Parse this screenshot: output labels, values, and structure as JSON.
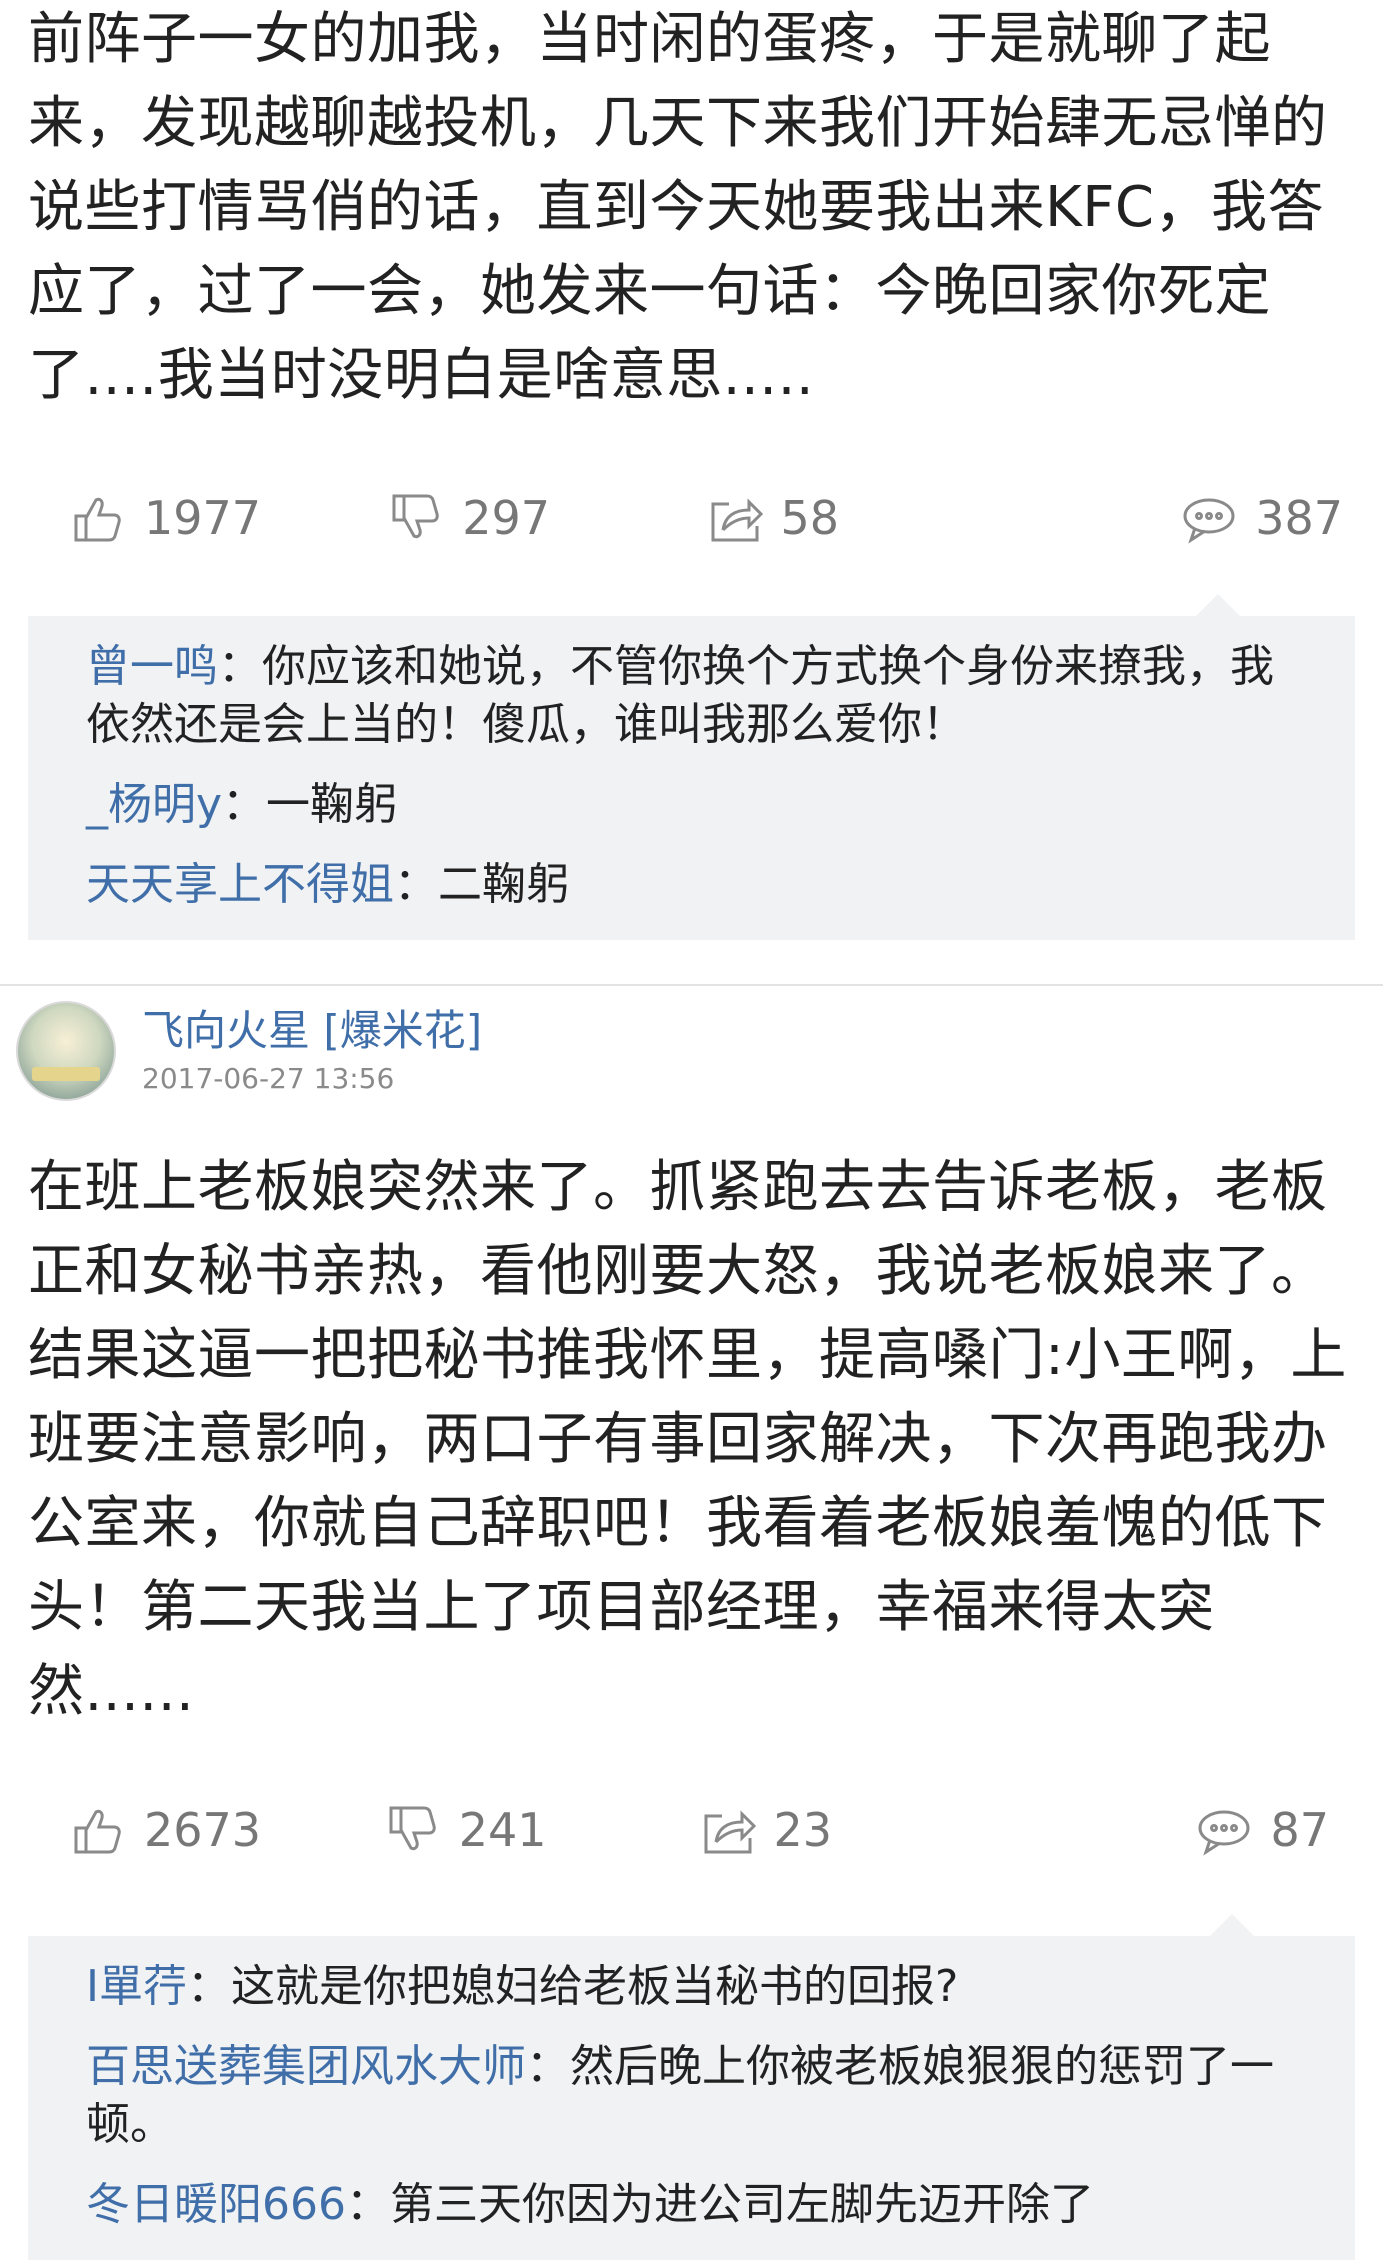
{
  "post1": {
    "text": "前阵子一女的加我，当时闲的蛋疼，于是就聊了起来，发现越聊越投机，几天下来我们开始肆无忌惮的说些打情骂俏的话，直到今天她要我出来KFC，我答应了，过了一会，她发来一句话：今晚回家你死定了....我当时没明白是啥意思.....",
    "likes": "1977",
    "dislikes": "297",
    "shares": "58",
    "comments": "387",
    "replies": [
      {
        "name": "曾一鸣",
        "text": "：你应该和她说，不管你换个方式换个身份来撩我，我依然还是会上当的！傻瓜，谁叫我那么爱你！"
      },
      {
        "name": "_杨明y",
        "text": "：一鞠躬"
      },
      {
        "name": "天天享上不得姐",
        "text": "：二鞠躬"
      }
    ]
  },
  "post2": {
    "author": "飞向火星 [爆米花]",
    "time": "2017-06-27 13:56",
    "text": "在班上老板娘突然来了。抓紧跑去去告诉老板，老板正和女秘书亲热，看他刚要大怒，我说老板娘来了。结果这逼一把把秘书推我怀里，提高嗓门:小王啊，上班要注意影响，两口子有事回家解决，下次再跑我办公室来，你就自己辞职吧！我看着老板娘羞愧的低下头！第二天我当上了项目部经理，幸福来得太突然......",
    "likes": "2673",
    "dislikes": "241",
    "shares": "23",
    "comments": "87",
    "replies": [
      {
        "name": "I單荇",
        "text": "：这就是你把媳妇给老板当秘书的回报?"
      },
      {
        "name": "百思送葬集团风水大师",
        "text": "：然后晚上你被老板娘狠狠的惩罚了一顿。"
      },
      {
        "name": "冬日暖阳666",
        "text": "：第三天你因为进公司左脚先迈开除了"
      }
    ]
  }
}
